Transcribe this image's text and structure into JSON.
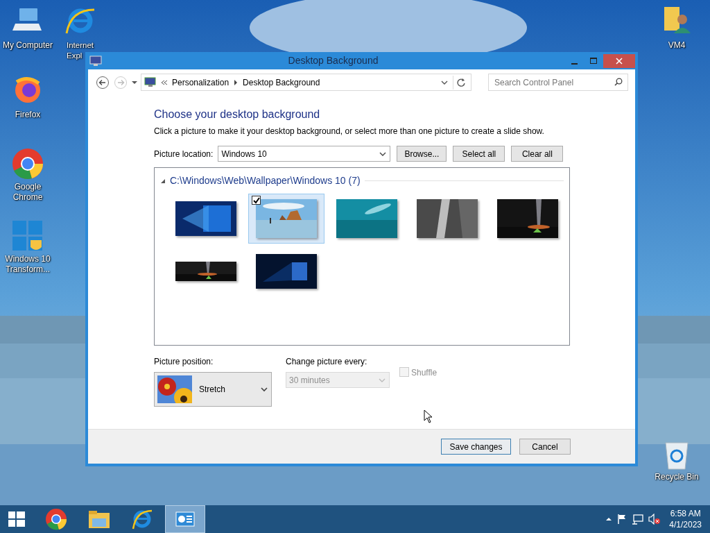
{
  "desktop_icons": [
    {
      "label": "My Computer",
      "kind": "computer"
    },
    {
      "label": "Internet Expl",
      "kind": "ie"
    },
    {
      "label": "Firefox",
      "kind": "firefox"
    },
    {
      "label": "Google Chrome",
      "kind": "chrome"
    },
    {
      "label": "Windows 10 Transform...",
      "kind": "windows"
    },
    {
      "label": "VM4",
      "kind": "user"
    },
    {
      "label": "Recycle Bin",
      "kind": "recycle"
    }
  ],
  "window": {
    "title": "Desktop Background",
    "address": {
      "crumbs": [
        "Personalization",
        "Desktop Background"
      ]
    },
    "search": {
      "placeholder": "Search Control Panel"
    },
    "heading": "Choose your desktop background",
    "description": "Click a picture to make it your desktop background, or select more than one picture to create a slide show.",
    "picture_location": {
      "label": "Picture location:",
      "value": "Windows 10"
    },
    "location_buttons": [
      "Browse...",
      "Select all",
      "Clear all"
    ],
    "folder": {
      "label": "C:\\Windows\\Web\\Wallpaper\\Windows 10 (7)",
      "expanded": true
    },
    "wallpapers": [
      {
        "kind": "windows-blue",
        "selected": false
      },
      {
        "kind": "beach",
        "selected": true
      },
      {
        "kind": "underwater",
        "selected": false
      },
      {
        "kind": "rock",
        "selected": false
      },
      {
        "kind": "night-sky",
        "selected": false
      },
      {
        "kind": "night-wide",
        "selected": false
      },
      {
        "kind": "windows-dark",
        "selected": false
      }
    ],
    "picture_position": {
      "label": "Picture position:",
      "value": "Stretch"
    },
    "change_interval": {
      "label": "Change picture every:",
      "value": "30 minutes",
      "disabled": true
    },
    "shuffle": {
      "label": "Shuffle",
      "checked": false,
      "disabled": true
    },
    "footer_buttons": [
      {
        "label": "Save changes",
        "default": true
      },
      {
        "label": "Cancel",
        "default": false
      }
    ]
  },
  "taskbar": {
    "apps": [
      {
        "kind": "start",
        "active": false
      },
      {
        "kind": "chrome",
        "active": false
      },
      {
        "kind": "explorer",
        "active": false
      },
      {
        "kind": "ie",
        "active": false
      },
      {
        "kind": "control-panel",
        "active": true
      }
    ],
    "time": "6:58 AM",
    "date": "4/1/2023"
  }
}
